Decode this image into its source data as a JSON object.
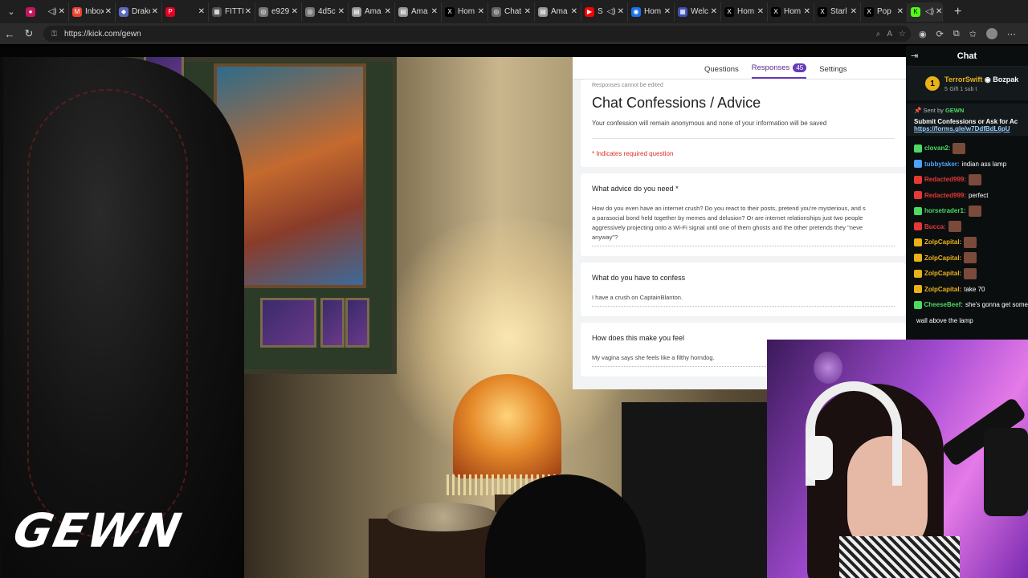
{
  "browser": {
    "tabs": [
      {
        "label": "",
        "fav_color": "#c2185b",
        "fav_glyph": "●",
        "audio": true
      },
      {
        "label": "Inbox",
        "fav_color": "#ea4335",
        "fav_glyph": "M"
      },
      {
        "label": "Drake",
        "fav_color": "#5c6bc0",
        "fav_glyph": "◆"
      },
      {
        "label": "",
        "fav_color": "#e60023",
        "fav_glyph": "P",
        "secondary_glyph": "▣"
      },
      {
        "label": "FITTI",
        "fav_color": "#555555",
        "fav_glyph": "▦"
      },
      {
        "label": "e929",
        "fav_color": "#777777",
        "fav_glyph": "◎"
      },
      {
        "label": "4d5c",
        "fav_color": "#777777",
        "fav_glyph": "◎"
      },
      {
        "label": "Ama",
        "fav_color": "#999999",
        "fav_glyph": "▤"
      },
      {
        "label": "Ama",
        "fav_color": "#999999",
        "fav_glyph": "▤"
      },
      {
        "label": "Hom",
        "fav_color": "#000000",
        "fav_glyph": "X"
      },
      {
        "label": "Chat",
        "fav_color": "#666666",
        "fav_glyph": "◎"
      },
      {
        "label": "Ama",
        "fav_color": "#999999",
        "fav_glyph": "▤"
      },
      {
        "label": "S",
        "fav_color": "#ff0000",
        "fav_glyph": "▶",
        "audio": true
      },
      {
        "label": "Hom",
        "fav_color": "#1a73e8",
        "fav_glyph": "◉"
      },
      {
        "label": "Welc",
        "fav_color": "#3f51b5",
        "fav_glyph": "▦"
      },
      {
        "label": "Hom",
        "fav_color": "#000000",
        "fav_glyph": "X"
      },
      {
        "label": "Hom",
        "fav_color": "#000000",
        "fav_glyph": "X"
      },
      {
        "label": "Starl",
        "fav_color": "#000000",
        "fav_glyph": "X"
      },
      {
        "label": "Pop",
        "fav_color": "#000000",
        "fav_glyph": "X"
      }
    ],
    "active_tab": {
      "fav_color": "#53fc18",
      "fav_glyph": "K",
      "audio": true
    },
    "new_tab_glyph": "+",
    "url": "https://kick.com/gewn"
  },
  "stream": {
    "logo_text": "GEWN"
  },
  "form": {
    "tabs": [
      {
        "label": "Questions"
      },
      {
        "label": "Responses",
        "badge": "45"
      },
      {
        "label": "Settings"
      }
    ],
    "readonly_note": "Responses cannot be edited",
    "title": "Chat Confessions / Advice",
    "description": "Your confession will remain anonymous and none of your information will be saved",
    "required_note": "* Indicates required question",
    "questions": [
      {
        "title": "What advice do you need *",
        "answer": "How do you even have an internet crush? Do you react to their posts, pretend you're mysterious, and s\na parasocial bond held together by memes and delusion? Or are internet relationships just two people\naggressively projecting onto a Wi-Fi signal until one of them ghosts and the other pretends they \"neve\nanyway\"?"
      },
      {
        "title": "What do you have to confess",
        "answer": "I have a crush on CaptainBlanton."
      },
      {
        "title": "How does this make you feel",
        "answer": "My vagina says she feels like a filthy horndog."
      }
    ]
  },
  "chat": {
    "title": "Chat",
    "gift": {
      "count": "1",
      "user": "TerrorSwift",
      "sub_count": "5",
      "recipient": "Bozpak",
      "note": "Gift 1 sub t"
    },
    "pinned": {
      "by_prefix": "Sent by",
      "by_user": "GEWN",
      "message": "Submit Confessions or Ask for Ac",
      "link": "https://forms.gle/w7DdfBdL6pU"
    },
    "messages": [
      {
        "user": "clovan2:",
        "user_color": "#4cd964",
        "text": "",
        "emote": true
      },
      {
        "user": "tubbytaker:",
        "user_color": "#4aa3ff",
        "text": "indian ass lamp"
      },
      {
        "user": "Redacted999:",
        "user_color": "#e53935",
        "text": "",
        "emote": true
      },
      {
        "user": "Redacted999:",
        "user_color": "#e53935",
        "text": "perfect"
      },
      {
        "user": "horsetrader1:",
        "user_color": "#4cd964",
        "text": "",
        "emote": true
      },
      {
        "user": "Bucca:",
        "user_color": "#e53935",
        "text": "",
        "emote": true
      },
      {
        "user": "ZolpCapital:",
        "user_color": "#e9b21a",
        "text": "",
        "emote": true
      },
      {
        "user": "ZolpCapital:",
        "user_color": "#e9b21a",
        "text": "",
        "emote": true
      },
      {
        "user": "ZolpCapital:",
        "user_color": "#e9b21a",
        "text": "",
        "emote": true
      },
      {
        "user": "ZolpCapital:",
        "user_color": "#e9b21a",
        "text": "take 70"
      },
      {
        "user": "CheeseBeef:",
        "user_color": "#4cd964",
        "text": "she's gonna get some"
      },
      {
        "user": "",
        "user_color": "#ffffff",
        "text": "wall above the lamp"
      }
    ]
  },
  "colors": {
    "accent": "#673ab7",
    "kick_green": "#53fc18",
    "chat_bg": "#0b0e0f"
  }
}
